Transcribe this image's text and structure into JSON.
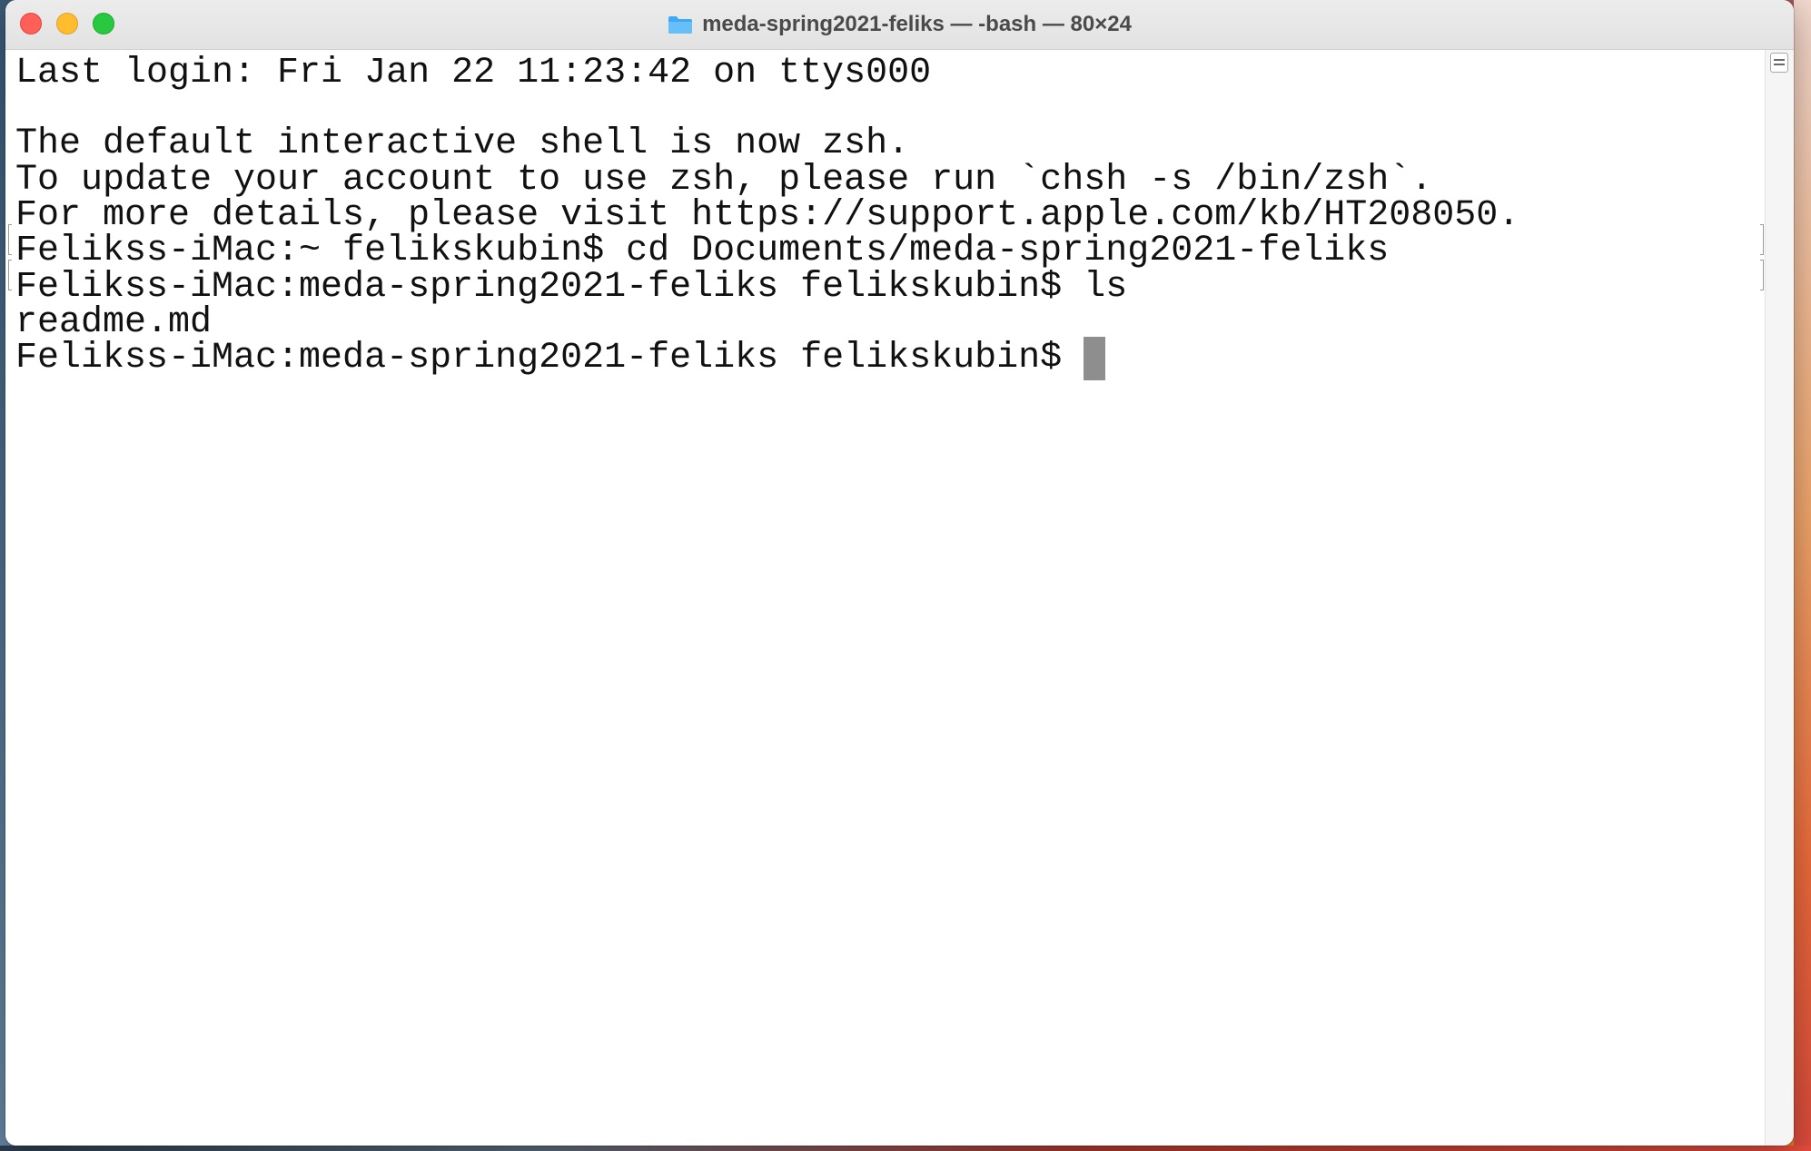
{
  "window": {
    "title": "meda-spring2021-feliks — -bash — 80×24",
    "title_icon": "folder-icon",
    "controls": [
      "close",
      "minimize",
      "zoom"
    ]
  },
  "colors": {
    "folder": "#3fa9f5",
    "text": "#111111",
    "cursor": "#8e8e8e"
  },
  "terminal": {
    "lines": [
      "Last login: Fri Jan 22 11:23:42 on ttys000",
      "",
      "The default interactive shell is now zsh.",
      "To update your account to use zsh, please run `chsh -s /bin/zsh`.",
      "For more details, please visit https://support.apple.com/kb/HT208050.",
      "Felikss-iMac:~ felikskubin$ cd Documents/meda-spring2021-feliks",
      "Felikss-iMac:meda-spring2021-feliks felikskubin$ ls",
      "readme.md",
      "Felikss-iMac:meda-spring2021-feliks felikskubin$ "
    ]
  }
}
